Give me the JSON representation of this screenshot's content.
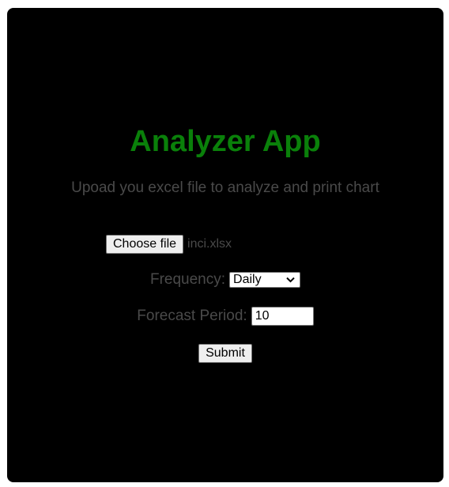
{
  "app": {
    "title": "Analyzer App",
    "subtitle": "Upoad you excel file to analyze and print chart"
  },
  "file": {
    "button_label": "Choose file",
    "selected_name": "inci.xlsx"
  },
  "frequency": {
    "label": "Frequency:",
    "selected": "Daily"
  },
  "forecast": {
    "label": "Forecast Period:",
    "value": "10"
  },
  "submit": {
    "label": "Submit"
  },
  "colors": {
    "card_bg": "#000000",
    "title": "#0a800a",
    "muted_text": "#4a4a4a"
  }
}
